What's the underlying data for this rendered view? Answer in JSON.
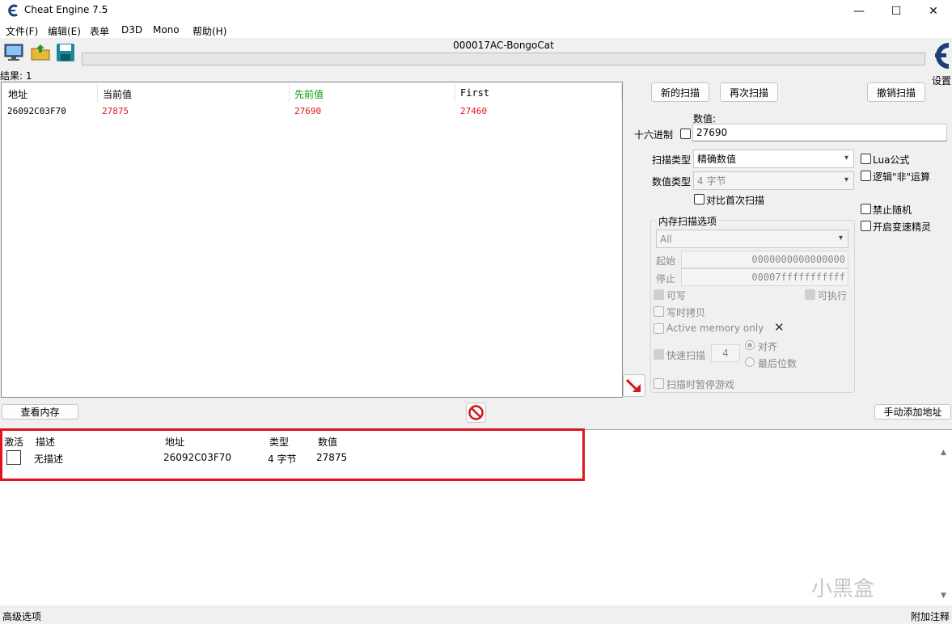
{
  "window": {
    "title": "Cheat Engine 7.5",
    "min": "—",
    "max": "☐",
    "close": "✕"
  },
  "menu": [
    "文件(F)",
    "编辑(E)",
    "表单",
    "D3D",
    "Mono",
    "帮助(H)"
  ],
  "toolbar": {
    "process_name": "000017AC-BongoCat",
    "settings_label": "设置"
  },
  "results": {
    "count_label": "结果: 1",
    "columns": [
      "地址",
      "当前值",
      "先前值",
      "First"
    ],
    "rows": [
      {
        "address": "26092C03F70",
        "current": "27875",
        "previous": "27690",
        "first": "27460"
      }
    ]
  },
  "scan": {
    "new_scan": "新的扫描",
    "next_scan": "再次扫描",
    "undo_scan": "撤销扫描",
    "value_label": "数值:",
    "hex_label": "十六进制",
    "value": "27690",
    "scan_type_label": "扫描类型",
    "scan_type": "精确数值",
    "value_type_label": "数值类型",
    "value_type": "4 字节",
    "compare_first": "对比首次扫描",
    "lua_formula": "Lua公式",
    "logic_not": "逻辑\"非\"运算",
    "disable_random": "禁止随机",
    "speedhack": "开启变速精灵"
  },
  "mem_options": {
    "title": "内存扫描选项",
    "region": "All",
    "start_label": "起始",
    "start": "0000000000000000",
    "stop_label": "停止",
    "stop": "00007fffffffffff",
    "writable": "可写",
    "executable": "可执行",
    "copy_on_write": "写时拷贝",
    "active_memory": "Active memory only",
    "fast_scan": "快速扫描",
    "fast_scan_value": "4",
    "align": "对齐",
    "last_digits": "最后位数",
    "pause_game": "扫描时暂停游戏"
  },
  "buttons": {
    "view_memory": "查看内存",
    "add_address": "手动添加地址"
  },
  "address_list": {
    "columns": [
      "激活",
      "描述",
      "地址",
      "类型",
      "数值"
    ],
    "rows": [
      {
        "description": "无描述",
        "address": "26092C03F70",
        "type": "4 字节",
        "value": "27875"
      }
    ]
  },
  "status": {
    "left": "高级选项",
    "right": "附加注释"
  },
  "watermark": "小黑盒",
  "colors": {
    "current": "#e0141e",
    "previous_header": "#0a9a0a",
    "highlight": "#e0141e"
  }
}
